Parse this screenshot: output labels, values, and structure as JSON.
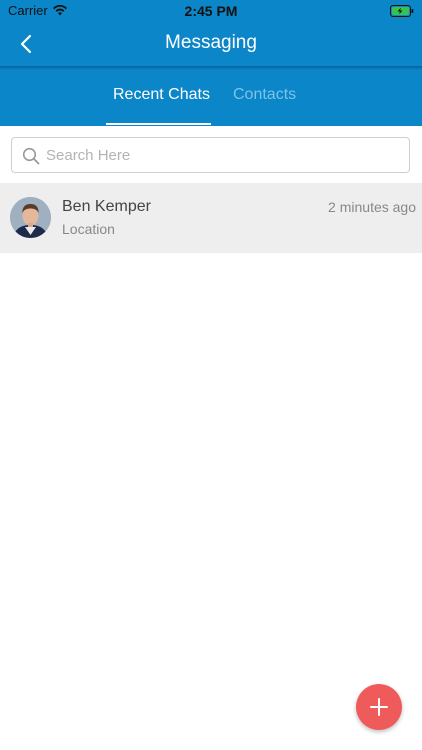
{
  "status_bar": {
    "carrier": "Carrier",
    "time": "2:45 PM"
  },
  "nav": {
    "title": "Messaging",
    "back_icon": "chevron-left-icon"
  },
  "tabs": [
    {
      "label": "Recent Chats",
      "active": true
    },
    {
      "label": "Contacts",
      "active": false
    }
  ],
  "search": {
    "placeholder": "Search Here",
    "value": ""
  },
  "chats": [
    {
      "name": "Ben Kemper",
      "preview": "Location",
      "time": "2 minutes ago",
      "avatar": "avatar-photo"
    }
  ],
  "fab": {
    "icon": "plus-icon"
  },
  "colors": {
    "primary": "#0a86c9",
    "inactive_tab": "#7cc3e6",
    "fab": "#ef5b5b",
    "row_bg": "#eeeeee"
  }
}
